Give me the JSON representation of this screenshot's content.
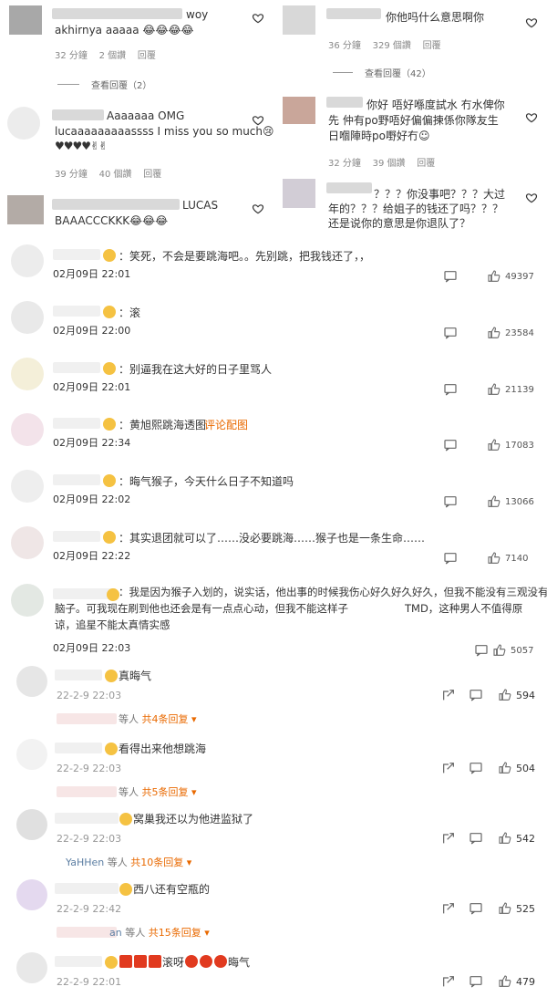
{
  "colors": {
    "orange": "#e96900",
    "time": "#333333",
    "meta": "#888888"
  },
  "ig": {
    "left": [
      {
        "text1": "woy",
        "text2": "akhirnya aaaaa 😂😂😂😂",
        "meta": [
          "32 分鐘",
          "2 個讚",
          "回覆"
        ],
        "view_replies": "查看回覆（2）"
      },
      {
        "text1": "Aaaaaaa OMG",
        "text2": "lucaaaaaaaaassss I miss you so much😢",
        "text3": "♥♥♥♥✌✌",
        "meta": [
          "39 分鐘",
          "40 個讚",
          "回覆"
        ]
      },
      {
        "text1": "LUCAS",
        "text2": "BAAACCCKKK😂😂😂"
      }
    ],
    "right": [
      {
        "text1": "你他吗什么意思啊你",
        "meta": [
          "36 分鐘",
          "329 個讚",
          "回覆"
        ],
        "view_replies": "查看回覆（42）"
      },
      {
        "text1": "你好 唔好喺度試水 冇水俾你",
        "text2": "先 仲有po野唔好偏偏揀係你隊友生",
        "text3": "日嗰陣時po嘢好冇☺",
        "meta": [
          "32 分鐘",
          "39 個讚",
          "回覆"
        ]
      },
      {
        "text1": "？？？你没事吧？？？大过",
        "text2": "年的？？？给姐子的钱还了吗？？？",
        "text3": "还是说你的意思是你退队了？"
      }
    ]
  },
  "weibo": [
    {
      "text": "：笑死，不会是要跳海吧。。先别跳，把我钱还了，，",
      "time": "02月09日 22:01",
      "likes": "49397"
    },
    {
      "text": "：滚",
      "time": "02月09日 22:00",
      "likes": "23584"
    },
    {
      "text": "：别逼我在这大好的日子里骂人",
      "time": "02月09日 22:01",
      "likes": "21139"
    },
    {
      "text": "：黄旭熙跳海透图",
      "link": "评论配图",
      "time": "02月09日 22:34",
      "likes": "17083"
    },
    {
      "text": "：晦气猴子，今天什么日子不知道吗",
      "time": "02月09日 22:02",
      "likes": "13066"
    },
    {
      "text": "：其实退团就可以了……没必要跳海……猴子也是一条生命……",
      "time": "02月09日 22:22",
      "likes": "7140"
    },
    {
      "text1": "：我是因为猴子入划的，说实话，他出事的时候我伤心好久好久好久，但我不能没有三观没有",
      "text2": "脑子。可我现在刷到他也还会是有一点点心动，但我不能这样子",
      "text2b": "TMD，这种男人不值得原",
      "text3": "谅，追星不能太真情实感",
      "time": "02月09日 22:03",
      "likes": "5057"
    }
  ],
  "weibo2": [
    {
      "text": "真晦气",
      "time": "22-2-9 22:03",
      "likes": "594",
      "more": "等人",
      "more_link": "共4条回复"
    },
    {
      "text": "看得出来他想跳海",
      "time": "22-2-9 22:03",
      "likes": "504",
      "more": "等人",
      "more_link": "共5条回复"
    },
    {
      "text": "窝巢我还以为他进监狱了",
      "time": "22-2-9 22:03",
      "likes": "542",
      "reply_name": "YaHHen",
      "more": "等人",
      "more_link": "共10条回复"
    },
    {
      "text": "西八还有空瓶的",
      "time": "22-2-9 22:42",
      "likes": "525",
      "reply_name_suffix": "an",
      "more": "等人",
      "more_link": "共15条回复"
    },
    {
      "text": "滚呀",
      "text_end": "晦气",
      "time": "22-2-9 22:01",
      "likes": "479"
    }
  ]
}
